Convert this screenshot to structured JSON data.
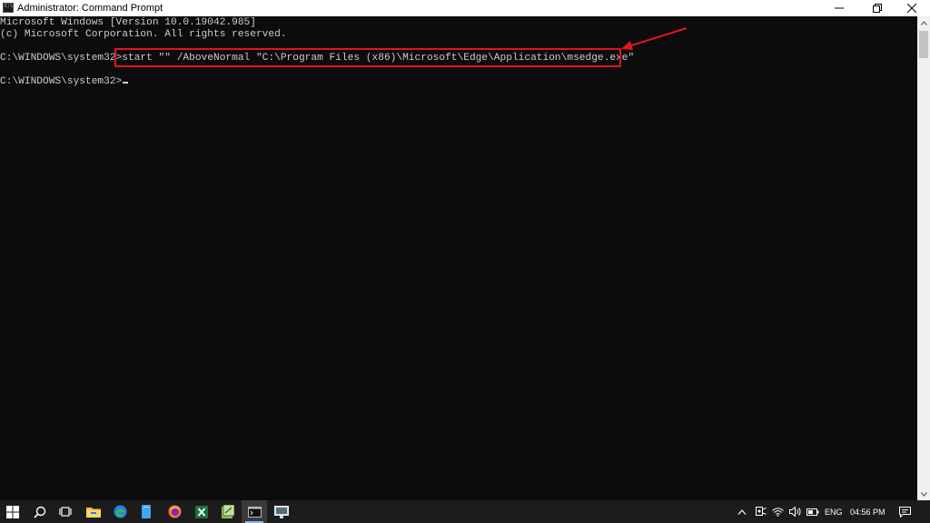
{
  "window": {
    "title": "Administrator: Command Prompt",
    "icon_label": "C:\\."
  },
  "console": {
    "lines": [
      "Microsoft Windows [Version 10.0.19042.985]",
      "(c) Microsoft Corporation. All rights reserved.",
      "",
      "C:\\WINDOWS\\system32>start \"\" /AboveNormal \"C:\\Program Files (x86)\\Microsoft\\Edge\\Application\\msedge.exe\"",
      "",
      "C:\\WINDOWS\\system32>"
    ],
    "highlight_color": "#e3141e"
  },
  "taskbar": {
    "icons": [
      "windows-start-icon",
      "search-icon",
      "task-view-icon",
      "file-explorer-icon",
      "edge-icon",
      "notepad-icon",
      "firefox-icon",
      "excel-icon",
      "notepadpp-icon",
      "command-prompt-icon",
      "remote-desktop-icon"
    ],
    "language": "ENG",
    "time": "04:56 PM"
  }
}
